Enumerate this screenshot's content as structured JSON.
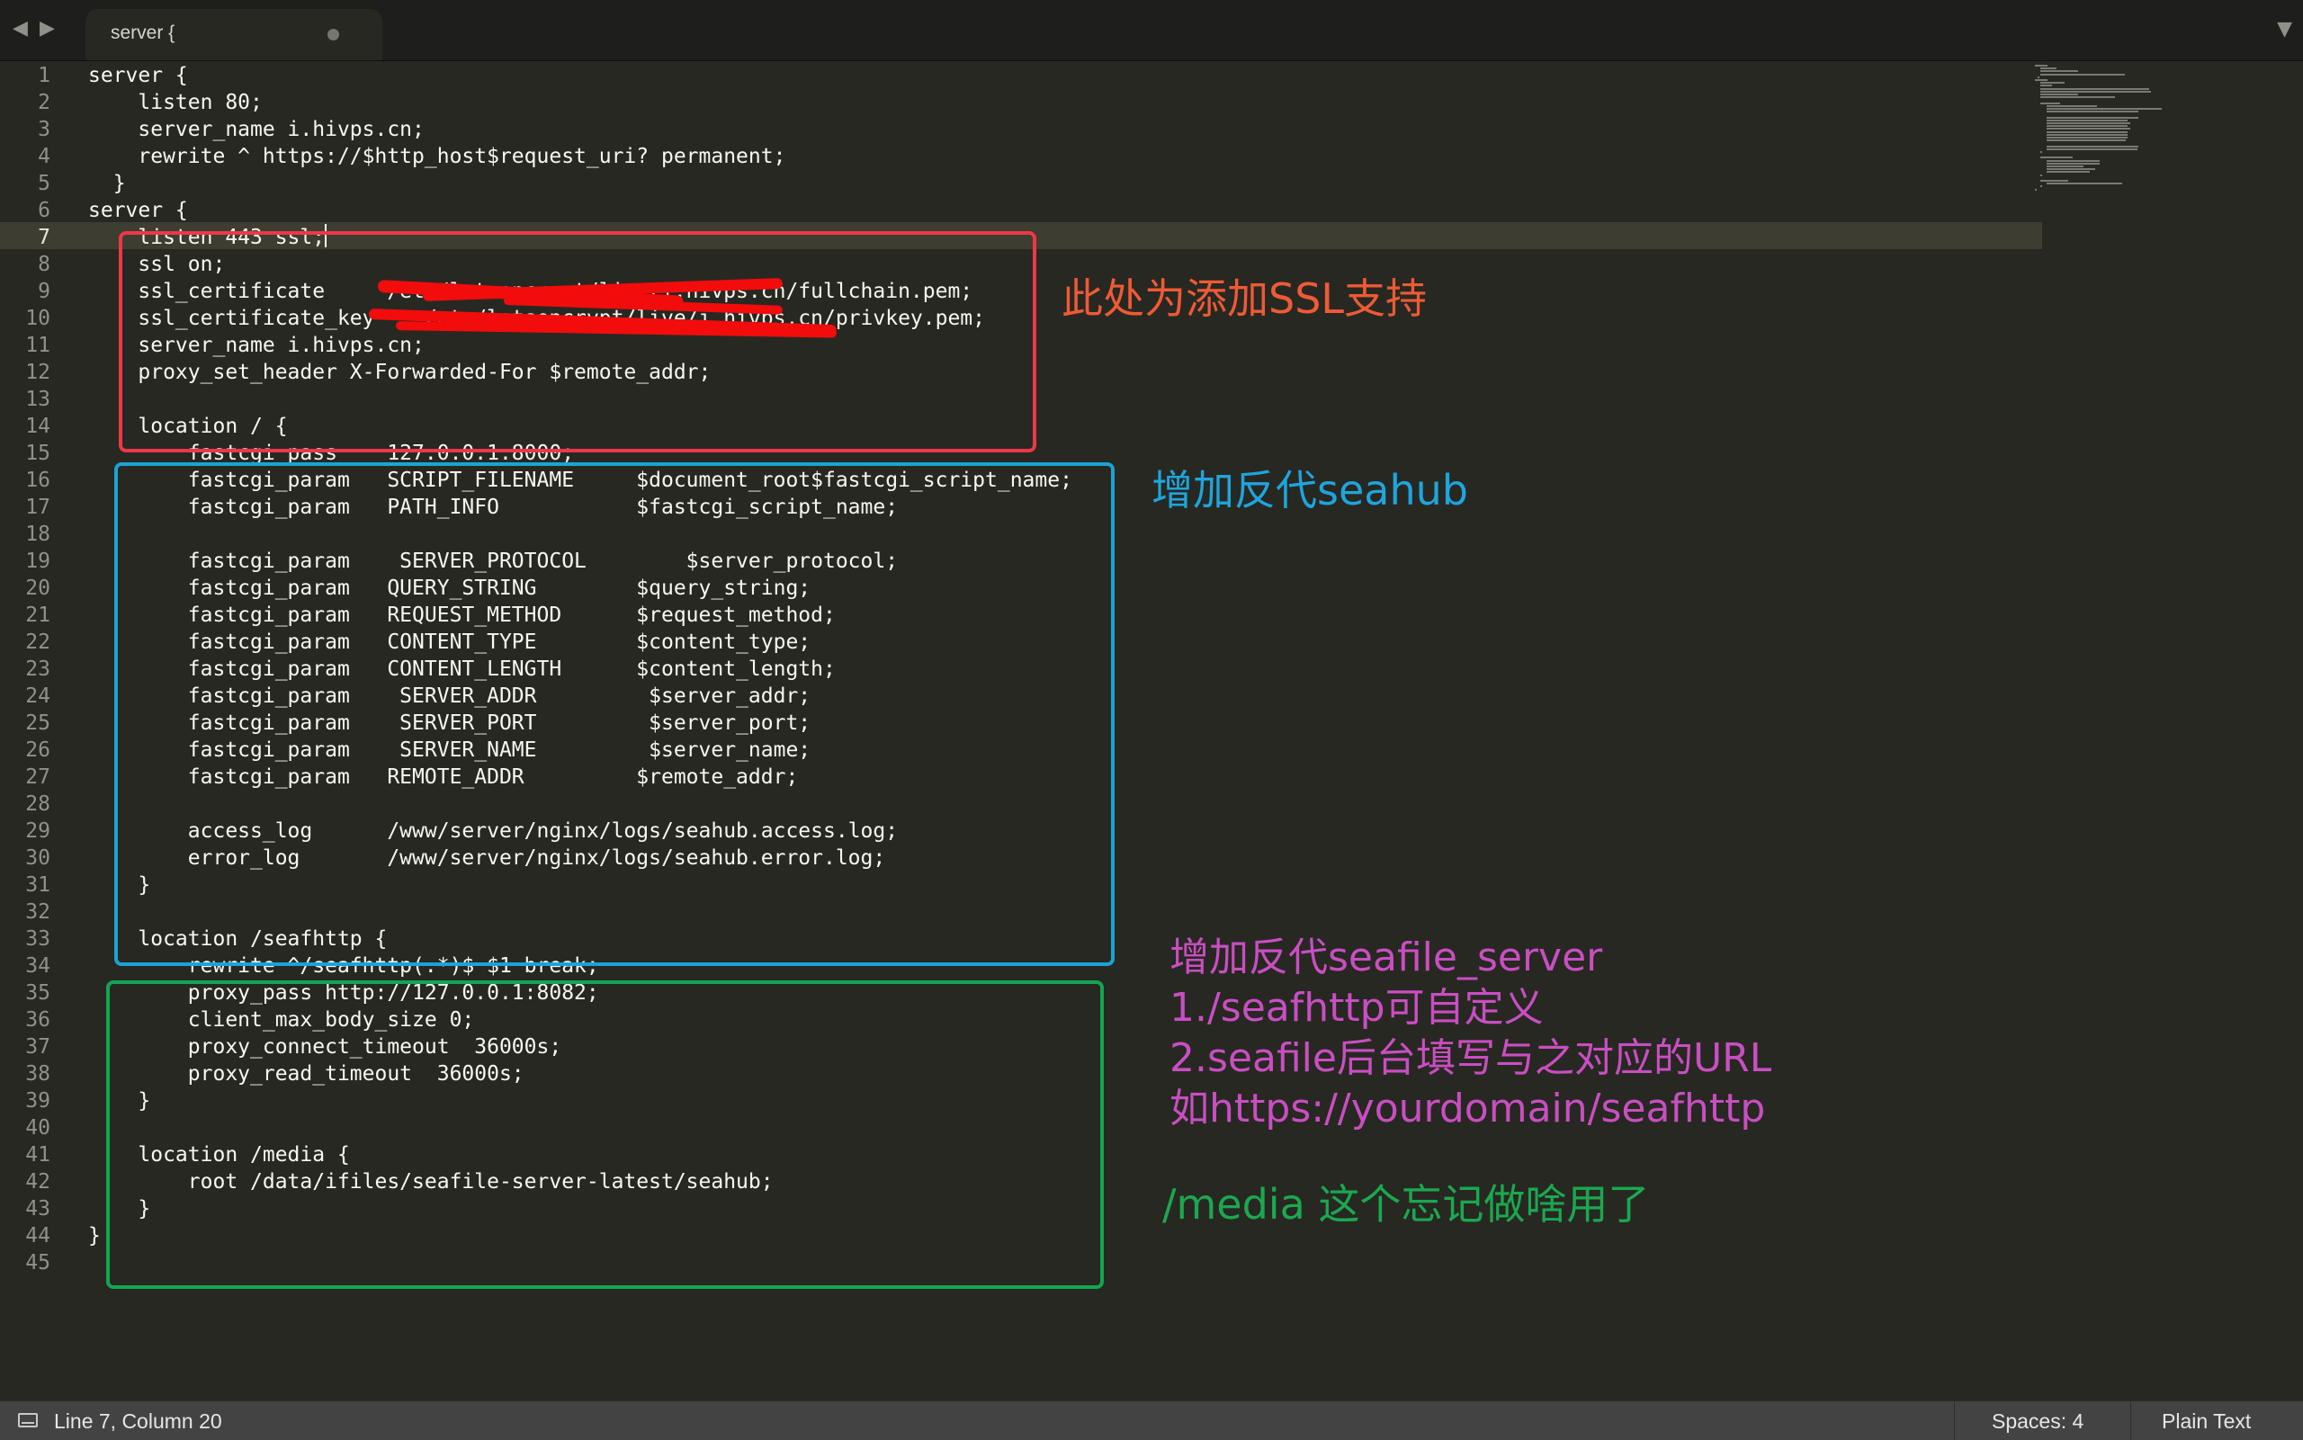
{
  "tab": {
    "title": "server {",
    "dirty_indicator": "●"
  },
  "nav": {
    "back_icon": "◀",
    "forward_icon": "▶",
    "menu_icon": "▼"
  },
  "editor": {
    "current_line": 7,
    "lines": [
      "server {",
      "    listen 80;",
      "    server_name i.hivps.cn;",
      "    rewrite ^ https://$http_host$request_uri? permanent;",
      "  }",
      "server {",
      "    listen 443 ssl;",
      "    ssl on;",
      "    ssl_certificate     /etc/letsencrypt/live/i.hivps.cn/fullchain.pem;",
      "    ssl_certificate_key    /etc/letsencrypt/live/i.hivps.cn/privkey.pem;",
      "    server_name i.hivps.cn;",
      "    proxy_set_header X-Forwarded-For $remote_addr;",
      "",
      "    location / {",
      "        fastcgi_pass    127.0.0.1:8000;",
      "        fastcgi_param   SCRIPT_FILENAME     $document_root$fastcgi_script_name;",
      "        fastcgi_param   PATH_INFO           $fastcgi_script_name;",
      "",
      "        fastcgi_param    SERVER_PROTOCOL        $server_protocol;",
      "        fastcgi_param   QUERY_STRING        $query_string;",
      "        fastcgi_param   REQUEST_METHOD      $request_method;",
      "        fastcgi_param   CONTENT_TYPE        $content_type;",
      "        fastcgi_param   CONTENT_LENGTH      $content_length;",
      "        fastcgi_param    SERVER_ADDR         $server_addr;",
      "        fastcgi_param    SERVER_PORT         $server_port;",
      "        fastcgi_param    SERVER_NAME         $server_name;",
      "        fastcgi_param   REMOTE_ADDR         $remote_addr;",
      "",
      "        access_log      /www/server/nginx/logs/seahub.access.log;",
      "        error_log       /www/server/nginx/logs/seahub.error.log;",
      "    }",
      "",
      "    location /seafhttp {",
      "        rewrite ^/seafhttp(.*)$ $1 break;",
      "        proxy_pass http://127.0.0.1:8082;",
      "        client_max_body_size 0;",
      "        proxy_connect_timeout  36000s;",
      "        proxy_read_timeout  36000s;",
      "    }",
      "",
      "    location /media {",
      "        root /data/ifiles/seafile-server-latest/seahub;",
      "    }",
      "}",
      ""
    ]
  },
  "annotations": {
    "ssl": "此处为添加SSL支持",
    "seahub": "增加反代seahub",
    "seafile_lines": [
      "增加反代seafile_server",
      "1./seafhttp可自定义",
      "2.seafile后台填写与之对应的URL",
      "如https://yourdomain/seafhttp"
    ],
    "media": "/media 这个忘记做啥用了"
  },
  "colors": {
    "background": "#272822",
    "red_box": "#ee3748",
    "blue_box": "#1ca3d6",
    "green_box": "#12a651",
    "ssl_text": "#ef5a35",
    "seahub_text": "#1ea5dd",
    "seafile_text": "#c94ec2",
    "media_text": "#1ba84f",
    "redaction": "#f20c0c"
  },
  "status": {
    "position": "Line 7, Column 20",
    "spaces": "Spaces: 4",
    "syntax": "Plain Text",
    "panel_icon": "panel-toggle-icon"
  }
}
